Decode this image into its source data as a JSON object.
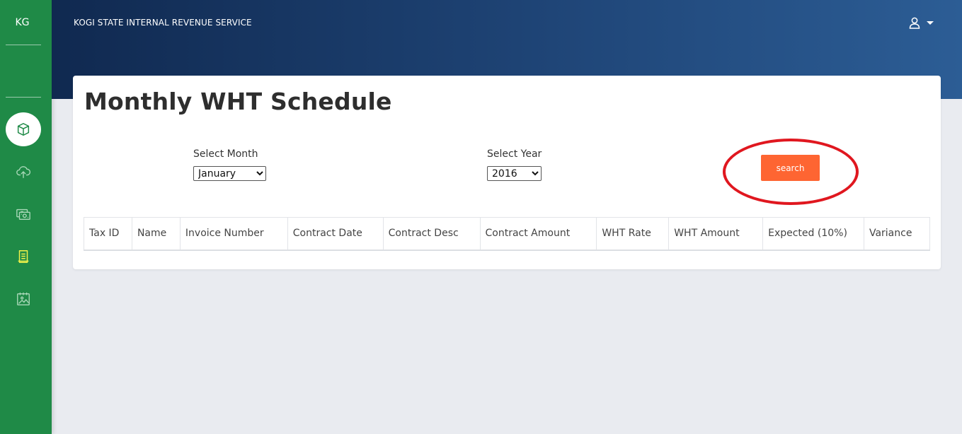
{
  "sidebar": {
    "brand": "KG",
    "nav": [
      {
        "icon": "box-icon",
        "active": true
      },
      {
        "icon": "cloud-upload-icon",
        "active": false
      },
      {
        "icon": "money-icon",
        "active": false
      },
      {
        "icon": "document-icon",
        "active": false,
        "highlighted": true
      },
      {
        "icon": "calendar-image-icon",
        "active": false
      }
    ]
  },
  "header": {
    "title": "KOGI STATE INTERNAL REVENUE SERVICE",
    "user_icon": "user-icon"
  },
  "main": {
    "title": "Monthly WHT Schedule",
    "month_label": "Select Month",
    "month_value": "January",
    "year_label": "Select Year",
    "year_value": "2016",
    "search_label": "search",
    "table": {
      "columns": [
        "Tax ID",
        "Name",
        "Invoice Number",
        "Contract Date",
        "Contract Desc",
        "Contract Amount",
        "WHT Rate",
        "WHT Amount",
        "Expected (10%)",
        "Variance"
      ],
      "rows": []
    }
  },
  "colors": {
    "sidebar": "#1f8a47",
    "header_start": "#102950",
    "header_end": "#2c5d95",
    "button": "#fe6532",
    "annotation_ring": "#e0171f",
    "active_nav_icon": "#f2f24a"
  }
}
